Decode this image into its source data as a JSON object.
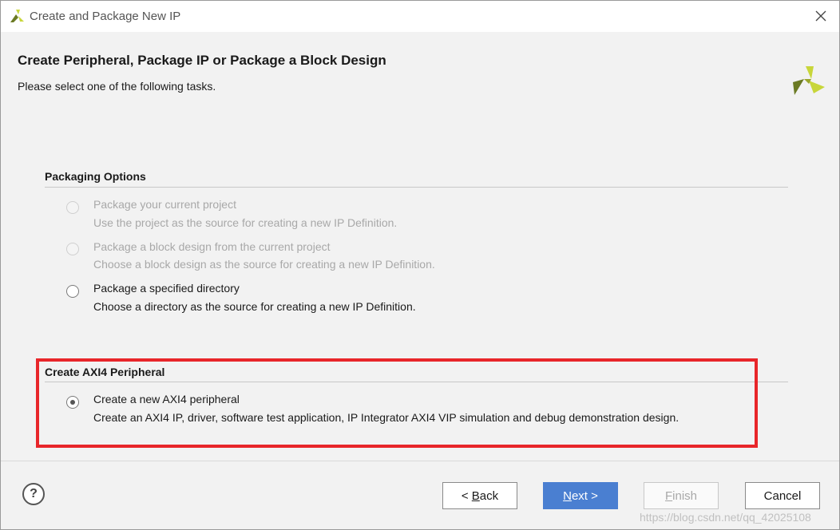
{
  "window": {
    "title": "Create and Package New IP"
  },
  "header": {
    "title": "Create Peripheral, Package IP or Package a Block Design",
    "subtitle": "Please select one of the following tasks."
  },
  "packaging": {
    "section_title": "Packaging Options",
    "options": [
      {
        "label": "Package your current project",
        "description": "Use the project as the source for creating a new IP Definition.",
        "enabled": false,
        "selected": false
      },
      {
        "label": "Package a block design from the current project",
        "description": "Choose a block design as the source for creating a new IP Definition.",
        "enabled": false,
        "selected": false
      },
      {
        "label": "Package a specified directory",
        "description": "Choose a directory as the source for creating a new IP Definition.",
        "enabled": true,
        "selected": false
      }
    ]
  },
  "axi": {
    "section_title": "Create AXI4 Peripheral",
    "options": [
      {
        "label": "Create a new AXI4 peripheral",
        "description": "Create an AXI4 IP, driver, software test application, IP Integrator AXI4 VIP simulation and debug demonstration design.",
        "enabled": true,
        "selected": true
      }
    ]
  },
  "footer": {
    "help": "?",
    "back": {
      "prefix": "< ",
      "mnemonic": "B",
      "rest": "ack"
    },
    "next": {
      "mnemonic": "N",
      "rest": "ext >"
    },
    "finish": {
      "mnemonic": "F",
      "rest": "inish"
    },
    "cancel": "Cancel"
  },
  "watermark": "https://blog.csdn.net/qq_42025108",
  "colors": {
    "accent": "#4a7fd1",
    "highlight": "#e8262a",
    "logo": "#c8d63a"
  },
  "icons": {
    "app": "xilinx-logo-icon",
    "close": "close-icon",
    "help": "help-icon"
  }
}
